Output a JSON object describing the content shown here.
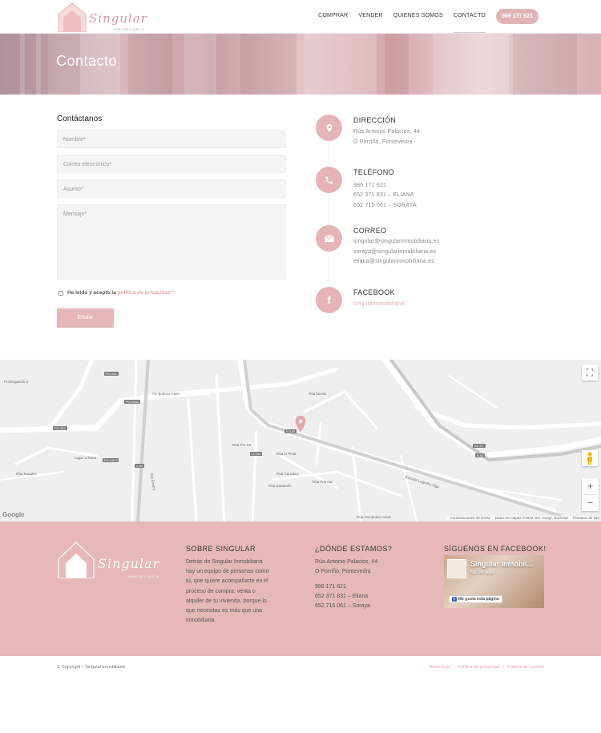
{
  "header": {
    "logo_text": "Singular",
    "logo_sub": "INMOBILIARIA",
    "nav": [
      "COMPRAR",
      "VENDER",
      "QUIENES SOMOS",
      "CONTACTO"
    ],
    "phone": "986 171 621"
  },
  "hero": {
    "title": "Contacto"
  },
  "form": {
    "title": "Contáctanos",
    "name_placeholder": "Nombre*",
    "email_placeholder": "Correo electrónico*",
    "subject_placeholder": "Asunto*",
    "message_placeholder": "Mensaje*",
    "consent_text": "He leído y acepto la",
    "consent_link": "política de privacidad *",
    "submit_label": "Enviar"
  },
  "contact": {
    "address": {
      "title": "DIRECCIÓN",
      "lines": [
        "Rúa Antonio Palacios, 44",
        "O Porriño, Pontevedra"
      ]
    },
    "phone": {
      "title": "TELÉFONO",
      "lines": [
        "986 171 621",
        "652 371 831 – ELIANA",
        "652 715 061 – SORAYA"
      ]
    },
    "email": {
      "title": "CORREO",
      "lines": [
        "singular@singularinmobiliaria.es",
        "soraya@singularinmobiliaria.es",
        "eliana@singularinmobiliaria.es"
      ]
    },
    "facebook": {
      "title": "FACEBOOK",
      "link": "singularinmobiliaria"
    }
  },
  "map": {
    "labels": [
      "Av. Buenos Aires",
      "Estrada Logroño-Vigo",
      "Rúa Fernández Areal",
      "Rúa Francia",
      "Rúa Sanamés",
      "Rúa Novas",
      "Rúa Pío XII",
      "Rúa O Pinal",
      "Rúa Carrasco",
      "Lugar a Rasa",
      "Río Enerro",
      "Prolongación a",
      "Rúa Rosales"
    ],
    "shields": [
      "PO-331",
      "PO-0404",
      "PO-0403",
      "A-55",
      "N-120",
      "N-550",
      "AG-57",
      "A-52",
      "PO-331"
    ],
    "google": "Google",
    "attribution": [
      "Combinaciones de teclas",
      "Datos de mapas ©2022 Inst. Geogr. Nacional",
      "Términos de uso"
    ]
  },
  "footer": {
    "logo_text": "Singular",
    "logo_sub": "INMOBILIARIA",
    "about_title": "SOBRE SINGULAR",
    "about_lines": [
      "Detrás de Singular Inmobiliaria",
      "hay un equipo de personas como",
      "tú, que quiere acompañarte en el",
      "proceso de compra, venta o",
      "alquiler de tu vivienda, porque lo",
      "que necesitas es más que una",
      "inmobiliaria."
    ],
    "where_title": "¿DÓNDE ESTAMOS?",
    "where_lines": [
      "Rúa Antonio Palacios, 44",
      "O Porriño, Pontevedra"
    ],
    "phones": [
      "986 171 621",
      "652 371 831 – Eliana",
      "652 715 061 – Soraya"
    ],
    "fb_title": "SÍGUENOS EN FACEBOOK!",
    "fb_page_name": "Singular Inmobil...",
    "fb_likes": "530 Me gusta",
    "fb_like_label": "Me gusta esta página"
  },
  "bottom": {
    "copyright": "© Copyright – Singular inmobiliaria",
    "legal": [
      "Aviso legal",
      "Política de privacidad",
      "Política de cookies"
    ]
  },
  "colors": {
    "accent": "#e6b4b7",
    "footer": "#e6b8ba",
    "link": "#e2a6ab"
  }
}
